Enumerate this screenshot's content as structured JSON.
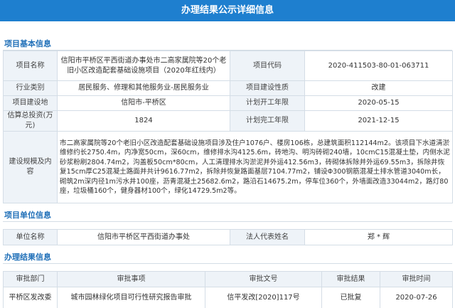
{
  "header": {
    "title": "办理结果公示详细信息"
  },
  "sections": {
    "basic": "项目基本信息",
    "unit": "项目单位信息",
    "result": "办理结果信息"
  },
  "basic": {
    "project_name_label": "项目名称",
    "project_name": "信阳市平桥区平西街道办事处市二高家属院等20个老旧小区改造配套基础设施项目（2020年红线内）",
    "project_code_label": "项目代码",
    "project_code": "2020-411503-80-01-063711",
    "industry_label": "行业类别",
    "industry": "居民服务、修理和其他服务业-居民服务业",
    "nature_label": "项目建设性质",
    "nature": "改建",
    "location_label": "项目建设地",
    "location": "信阳市-平桥区",
    "start_label": "计划开工年限",
    "start": "2020-05-15",
    "investment_label": "估算总投资(万元)",
    "investment": "1824",
    "end_label": "计划完工年限",
    "end": "2021-12-15",
    "scale_label": "建设规模及内容",
    "scale": "市二高家属院等20个老旧小区改造配套基础设施项目涉及住户1076户、楼房106栋，总建筑面积112144m2。该项目下水道清淤维修约长2750.4m，内净宽50cm，深60cm，维修排水沟4125.6m，砖地沟、明沟砖砌240墙，10cmC15混凝土垫，内侧水泥砂浆粉刷2804.74m2，沟盖板50cm*80cm，人工清理排水沟淤泥并外运412.56m3，砖砌体拆除并外运69.55m3，拆除井恢复15cm厚C25混凝土路面并共计9616.77m2，拆除并恢复路面基层7104.77m2，铺设Φ300钢筋混凝土排水管道3040m长，砌筑2m深内径1m污水井100座，沥青混凝土25682.6m2，路沿石14675.2m，停车位360个，外墙面改造33044m2，路灯80座，垃圾桶160个，健身器材100个，绿化14729.5m2等。"
  },
  "unit": {
    "unit_name_label": "单位名称",
    "unit_name": "信阳市平桥区平西街道办事处",
    "legal_label": "法人代表姓名",
    "legal": "郑 * 辉"
  },
  "result": {
    "headers": [
      "审批部门",
      "审批事项",
      "审批文号",
      "审批结果",
      "审批时间"
    ],
    "rows": [
      [
        "平桥区发改委",
        "城市园林绿化项目可行性研究报告审批",
        "信平发改[2020]117号",
        "已批复",
        "2020-07-26"
      ]
    ]
  }
}
